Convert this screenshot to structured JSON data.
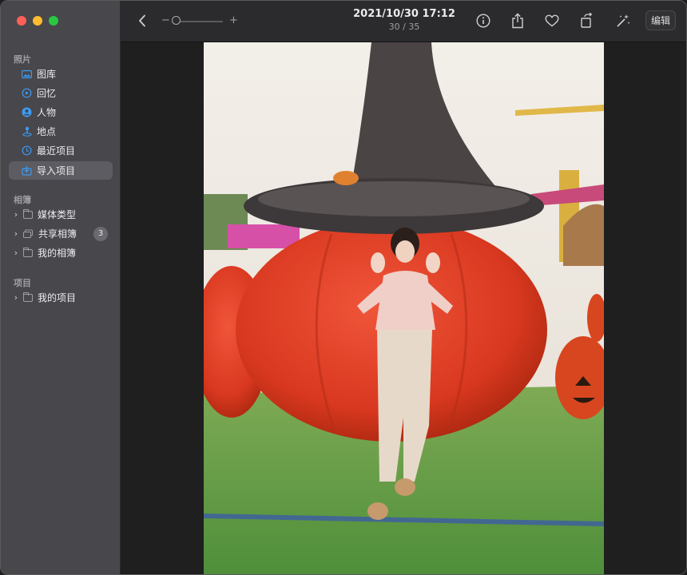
{
  "sidebar": {
    "sections": [
      {
        "title": "照片"
      },
      {
        "title": "相簿"
      },
      {
        "title": "项目"
      }
    ],
    "library_items": [
      {
        "label": "图库",
        "icon": "photo-library-icon"
      },
      {
        "label": "回忆",
        "icon": "memories-icon"
      },
      {
        "label": "人物",
        "icon": "people-icon"
      },
      {
        "label": "地点",
        "icon": "places-icon"
      },
      {
        "label": "最近项目",
        "icon": "recents-icon"
      },
      {
        "label": "导入项目",
        "icon": "imports-icon",
        "selected": true
      }
    ],
    "album_items": [
      {
        "label": "媒体类型",
        "icon": "folder-icon"
      },
      {
        "label": "共享相簿",
        "icon": "shared-albums-icon",
        "badge": "3"
      },
      {
        "label": "我的相簿",
        "icon": "folder-icon"
      }
    ],
    "project_items": [
      {
        "label": "我的项目",
        "icon": "folder-icon"
      }
    ]
  },
  "toolbar": {
    "date": "2021/10/30 17:12",
    "count": "30 / 35",
    "edit_label": "编辑",
    "zoom_minus": "−",
    "zoom_plus": "+",
    "zoom_level": 0.0
  },
  "colors": {
    "accent": "#3a9cf5",
    "sidebar_bg": "#48474c",
    "toolbar_bg": "#2b2b2d",
    "content_bg": "#1f1f20"
  }
}
